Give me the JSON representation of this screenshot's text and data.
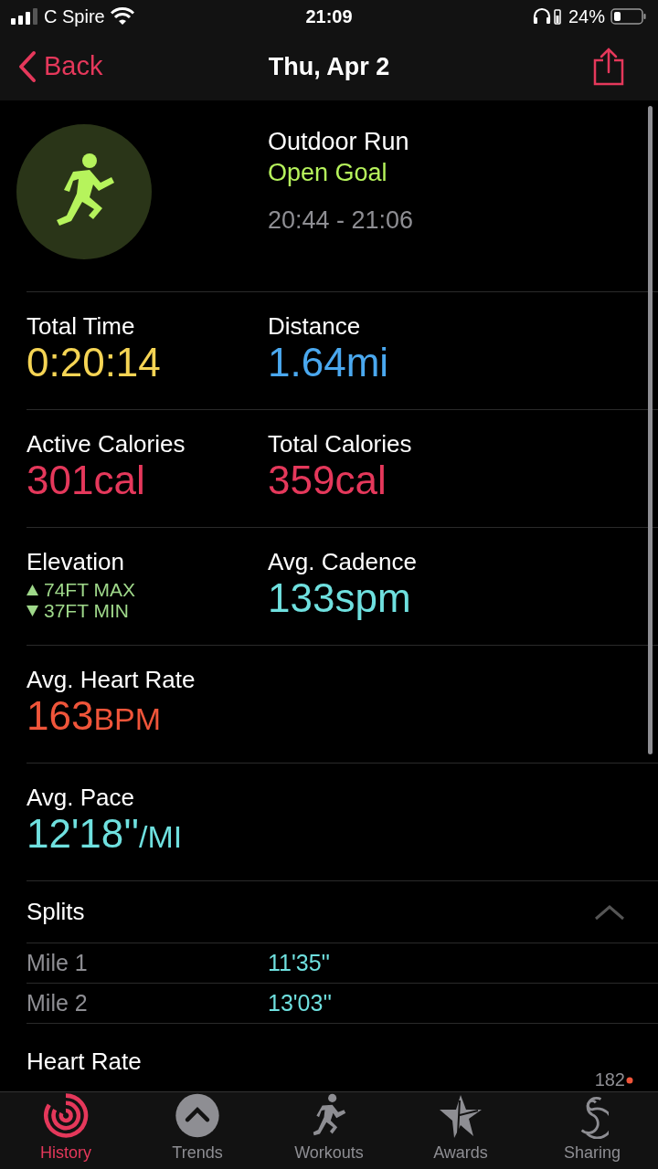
{
  "status_bar": {
    "carrier": "C Spire",
    "time": "21:09",
    "battery": "24%"
  },
  "nav": {
    "back": "Back",
    "title": "Thu, Apr 2"
  },
  "workout": {
    "name": "Outdoor Run",
    "goal": "Open Goal",
    "time_range": "20:44 - 21:06"
  },
  "metric_rows": [
    [
      {
        "kind": "value",
        "label": "Total Time",
        "value": "0:20:14",
        "color": "#f5d454"
      },
      {
        "kind": "value",
        "label": "Distance",
        "value": "1.64",
        "unit": "mi",
        "color": "#4aa8ef"
      }
    ],
    [
      {
        "kind": "value",
        "label": "Active Calories",
        "value": "301",
        "unit": "cal",
        "color": "#e5385b"
      },
      {
        "kind": "value",
        "label": "Total Calories",
        "value": "359",
        "unit": "cal",
        "color": "#e5385b"
      }
    ],
    [
      {
        "kind": "elevation",
        "label": "Elevation",
        "max": "74FT MAX",
        "min": "37FT MIN",
        "color": "#9fd88a"
      },
      {
        "kind": "value",
        "label": "Avg. Cadence",
        "value": "133",
        "unit": "spm",
        "color": "#6fe0df"
      }
    ],
    [
      {
        "kind": "value",
        "label": "Avg. Heart Rate",
        "value": "163",
        "unit": "BPM",
        "small_unit": true,
        "color": "#f0553a"
      }
    ],
    [
      {
        "kind": "value",
        "label": "Avg. Pace",
        "value": "12'18''",
        "unit": "/MI",
        "small_unit": true,
        "color": "#6fe0df"
      }
    ]
  ],
  "splits": {
    "title": "Splits",
    "expanded": true,
    "rows": [
      {
        "label": "Mile 1",
        "value": "11'35''"
      },
      {
        "label": "Mile 2",
        "value": "13'03''"
      }
    ]
  },
  "heart_rate": {
    "title": "Heart Rate",
    "max_label": "182"
  },
  "tabs": [
    {
      "label": "History",
      "selected": true
    },
    {
      "label": "Trends",
      "selected": false
    },
    {
      "label": "Workouts",
      "selected": false
    },
    {
      "label": "Awards",
      "selected": false
    },
    {
      "label": "Sharing",
      "selected": false
    }
  ]
}
